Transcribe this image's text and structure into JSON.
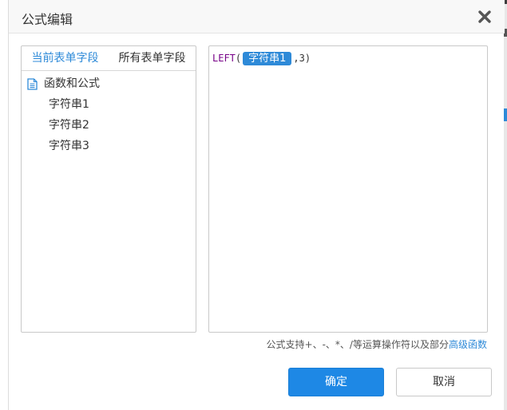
{
  "dialog": {
    "title": "公式编辑"
  },
  "left_panel": {
    "tabs": [
      {
        "label": "当前表单字段",
        "active": true
      },
      {
        "label": "所有表单字段",
        "active": false
      }
    ],
    "tree": {
      "root_label": "函数和公式",
      "items": [
        "字符串1",
        "字符串2",
        "字符串3"
      ]
    }
  },
  "editor": {
    "function_name": "LEFT",
    "open_paren": "(",
    "field_token": "字符串1",
    "argument": ",3)"
  },
  "hint": {
    "text": "公式支持+、-、*、/等运算操作符以及部分",
    "link": "高级函数"
  },
  "buttons": {
    "ok": "确定",
    "cancel": "取消"
  },
  "colors": {
    "accent": "#1e88e5",
    "link": "#2e8ad8",
    "function": "#770088"
  },
  "icons": {
    "close": "close-icon",
    "document": "document-icon"
  }
}
